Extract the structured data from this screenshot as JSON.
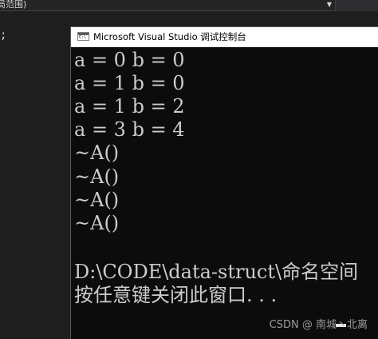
{
  "ide": {
    "scope_dropdown_label": "局范围)",
    "code_fragment": ";"
  },
  "console": {
    "title": "Microsoft Visual Studio 调试控制台",
    "icon_glyph": "C:\\",
    "lines": [
      "a = 0 b = 0",
      "a = 1 b = 0",
      "a = 1 b = 2",
      "a = 3 b = 4",
      "~A()",
      "~A()",
      "~A()",
      "~A()",
      "",
      "D:\\CODE\\data-struct\\命名空间",
      "按任意键关闭此窗口. . ."
    ],
    "cursor_color": "#e6e6e6"
  },
  "watermark": {
    "text": "CSDN @ 南城丶北离"
  },
  "colors": {
    "console_background": "#0c0c0c",
    "console_text": "#cccccc",
    "title_bar": "#ffffff",
    "ide_background": "#1e1e1e",
    "code_green": "#7ec16e"
  },
  "icons": {
    "dropdown": "chevron-down-icon",
    "console_app": "console-app-icon"
  }
}
